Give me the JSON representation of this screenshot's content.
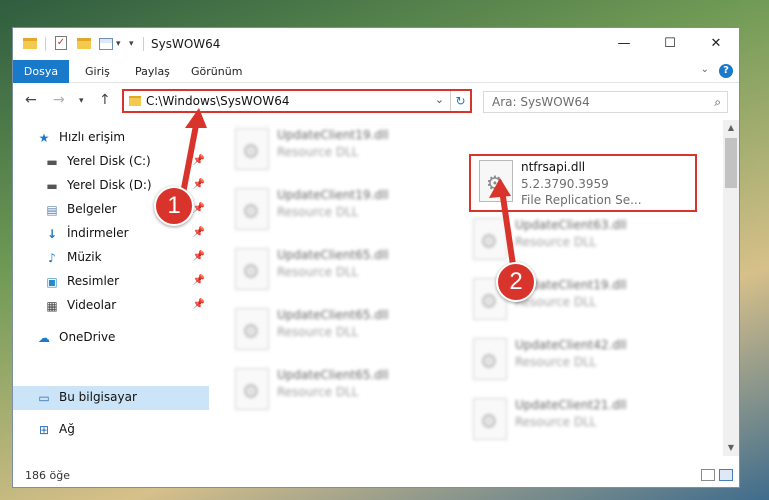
{
  "window": {
    "title": "SysWOW64",
    "controls": {
      "minimize": "—",
      "maximize": "☐",
      "close": "✕"
    }
  },
  "ribbon": {
    "tabs": [
      "Dosya",
      "Giriş",
      "Paylaş",
      "Görünüm"
    ]
  },
  "address": {
    "path": "C:\\Windows\\SysWOW64"
  },
  "search": {
    "placeholder": "Ara: SysWOW64"
  },
  "sidebar": {
    "items": [
      {
        "label": "Hızlı erişim",
        "icon": "star-icon"
      },
      {
        "label": "Yerel Disk (C:)",
        "icon": "drive-icon",
        "pinned": true
      },
      {
        "label": "Yerel Disk (D:)",
        "icon": "drive-icon",
        "pinned": true
      },
      {
        "label": "Belgeler",
        "icon": "documents-icon",
        "pinned": true
      },
      {
        "label": "İndirmeler",
        "icon": "download-icon",
        "pinned": true
      },
      {
        "label": "Müzik",
        "icon": "music-icon",
        "pinned": true
      },
      {
        "label": "Resimler",
        "icon": "pictures-icon",
        "pinned": true
      },
      {
        "label": "Videolar",
        "icon": "videos-icon",
        "pinned": true
      },
      {
        "label": "OneDrive",
        "icon": "cloud-icon"
      },
      {
        "label": "Bu bilgisayar",
        "icon": "computer-icon",
        "selected": true
      },
      {
        "label": "Ağ",
        "icon": "network-icon"
      }
    ]
  },
  "files": {
    "highlighted": {
      "name": "ntfrsapi.dll",
      "version": "5.2.3790.3959",
      "description": "File Replication Se..."
    },
    "left_column": [
      {
        "name": "UpdateClient19.dll",
        "type": "Resource DLL"
      },
      {
        "name": "UpdateClient19.dll",
        "type": "Resource DLL"
      },
      {
        "name": "UpdateClient65.dll",
        "type": "Resource DLL"
      },
      {
        "name": "UpdateClient65.dll",
        "type": "Resource DLL"
      },
      {
        "name": "UpdateClient65.dll",
        "type": "Resource DLL"
      }
    ],
    "right_column": [
      {
        "name": "UpdateClient63.dll",
        "type": "Resource DLL"
      },
      {
        "name": "UpdateClient19.dll",
        "type": "Resource DLL"
      },
      {
        "name": "UpdateClient42.dll",
        "type": "Resource DLL"
      },
      {
        "name": "UpdateClient21.dll",
        "type": "Resource DLL"
      }
    ]
  },
  "status": {
    "count": "186 öğe"
  },
  "annotations": {
    "badge1": "1",
    "badge2": "2",
    "color": "#d9342b"
  }
}
